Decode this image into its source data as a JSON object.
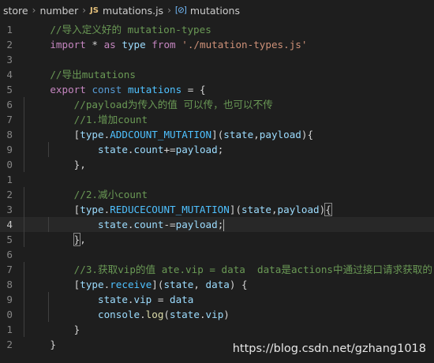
{
  "breadcrumb": {
    "items": [
      "store",
      "number",
      "mutations.js",
      "mutations"
    ],
    "file_icon_text": "JS",
    "symbol_icon_text": "[⊘]"
  },
  "editor": {
    "line_numbers": [
      "1",
      "2",
      "3",
      "4",
      "5",
      "6",
      "7",
      "8",
      "9",
      "0",
      "1",
      "2",
      "3",
      "4",
      "5",
      "6",
      "7",
      "8",
      "9",
      "0",
      "1",
      "2"
    ],
    "current_line_index": 13,
    "lines": [
      [
        {
          "t": "    "
        },
        {
          "t": "//导入定义好的 mutation-types",
          "c": "cm"
        }
      ],
      [
        {
          "t": "    "
        },
        {
          "t": "import",
          "c": "kc"
        },
        {
          "t": " * ",
          "c": "pn"
        },
        {
          "t": "as",
          "c": "kc"
        },
        {
          "t": " ",
          "c": "pn"
        },
        {
          "t": "type",
          "c": "var"
        },
        {
          "t": " ",
          "c": "pn"
        },
        {
          "t": "from",
          "c": "kc"
        },
        {
          "t": " ",
          "c": "pn"
        },
        {
          "t": "'./mutation-types.js'",
          "c": "str"
        }
      ],
      [],
      [
        {
          "t": "    "
        },
        {
          "t": "//导出mutations",
          "c": "cm"
        }
      ],
      [
        {
          "t": "    "
        },
        {
          "t": "export",
          "c": "kc"
        },
        {
          "t": " ",
          "c": "pn"
        },
        {
          "t": "const",
          "c": "kw"
        },
        {
          "t": " ",
          "c": "pn"
        },
        {
          "t": "mutations",
          "c": "cst"
        },
        {
          "t": " = {",
          "c": "pn"
        }
      ],
      [
        {
          "t": "        "
        },
        {
          "t": "//payload为传入的值 可以传，也可以不传",
          "c": "cm"
        }
      ],
      [
        {
          "t": "        "
        },
        {
          "t": "//1.增加count",
          "c": "cm"
        }
      ],
      [
        {
          "t": "        "
        },
        {
          "t": "[",
          "c": "pn"
        },
        {
          "t": "type",
          "c": "var"
        },
        {
          "t": ".",
          "c": "pn"
        },
        {
          "t": "ADDCOUNT_MUTATION",
          "c": "cst"
        },
        {
          "t": "](",
          "c": "pn"
        },
        {
          "t": "state",
          "c": "var"
        },
        {
          "t": ",",
          "c": "pn"
        },
        {
          "t": "payload",
          "c": "var"
        },
        {
          "t": "){",
          "c": "pn"
        }
      ],
      [
        {
          "t": "            "
        },
        {
          "t": "state",
          "c": "var"
        },
        {
          "t": ".",
          "c": "pn"
        },
        {
          "t": "count",
          "c": "var"
        },
        {
          "t": "+=",
          "c": "pn"
        },
        {
          "t": "payload",
          "c": "var"
        },
        {
          "t": ";",
          "c": "pn"
        }
      ],
      [
        {
          "t": "        "
        },
        {
          "t": "},",
          "c": "pn"
        }
      ],
      [],
      [
        {
          "t": "        "
        },
        {
          "t": "//2.减小count",
          "c": "cm"
        }
      ],
      [
        {
          "t": "        "
        },
        {
          "t": "[",
          "c": "pn"
        },
        {
          "t": "type",
          "c": "var"
        },
        {
          "t": ".",
          "c": "pn"
        },
        {
          "t": "REDUCECOUNT_MUTATION",
          "c": "cst"
        },
        {
          "t": "](",
          "c": "pn"
        },
        {
          "t": "state",
          "c": "var"
        },
        {
          "t": ",",
          "c": "pn"
        },
        {
          "t": "payload",
          "c": "var"
        },
        {
          "t": ")",
          "c": "pn"
        },
        {
          "t": "{",
          "c": "pn",
          "box": true
        }
      ],
      [
        {
          "t": "            "
        },
        {
          "t": "state",
          "c": "var"
        },
        {
          "t": ".",
          "c": "pn"
        },
        {
          "t": "count",
          "c": "var"
        },
        {
          "t": "-=",
          "c": "pn"
        },
        {
          "t": "payload",
          "c": "var"
        },
        {
          "t": ";",
          "c": "pn"
        },
        {
          "cursor": true
        }
      ],
      [
        {
          "t": "        "
        },
        {
          "t": "}",
          "c": "pn",
          "box": true
        },
        {
          "t": ",",
          "c": "pn"
        }
      ],
      [],
      [
        {
          "t": "        "
        },
        {
          "t": "//3.获取vip的值 ate.vip = data  data是actions中通过接口请求获取的",
          "c": "cm"
        }
      ],
      [
        {
          "t": "        "
        },
        {
          "t": "[",
          "c": "pn"
        },
        {
          "t": "type",
          "c": "var"
        },
        {
          "t": ".",
          "c": "pn"
        },
        {
          "t": "receive",
          "c": "cst"
        },
        {
          "t": "](",
          "c": "pn"
        },
        {
          "t": "state",
          "c": "var"
        },
        {
          "t": ", ",
          "c": "pn"
        },
        {
          "t": "data",
          "c": "var"
        },
        {
          "t": ") {",
          "c": "pn"
        }
      ],
      [
        {
          "t": "            "
        },
        {
          "t": "state",
          "c": "var"
        },
        {
          "t": ".",
          "c": "pn"
        },
        {
          "t": "vip",
          "c": "var"
        },
        {
          "t": " = ",
          "c": "pn"
        },
        {
          "t": "data",
          "c": "var"
        }
      ],
      [
        {
          "t": "            "
        },
        {
          "t": "console",
          "c": "var"
        },
        {
          "t": ".",
          "c": "pn"
        },
        {
          "t": "log",
          "c": "fn"
        },
        {
          "t": "(",
          "c": "pn"
        },
        {
          "t": "state",
          "c": "var"
        },
        {
          "t": ".",
          "c": "pn"
        },
        {
          "t": "vip",
          "c": "var"
        },
        {
          "t": ")",
          "c": "pn"
        }
      ],
      [
        {
          "t": "        "
        },
        {
          "t": "}",
          "c": "pn"
        }
      ],
      [
        {
          "t": "    "
        },
        {
          "t": "}",
          "c": "pn"
        }
      ]
    ]
  },
  "watermark": "https://blog.csdn.net/gzhang1018"
}
